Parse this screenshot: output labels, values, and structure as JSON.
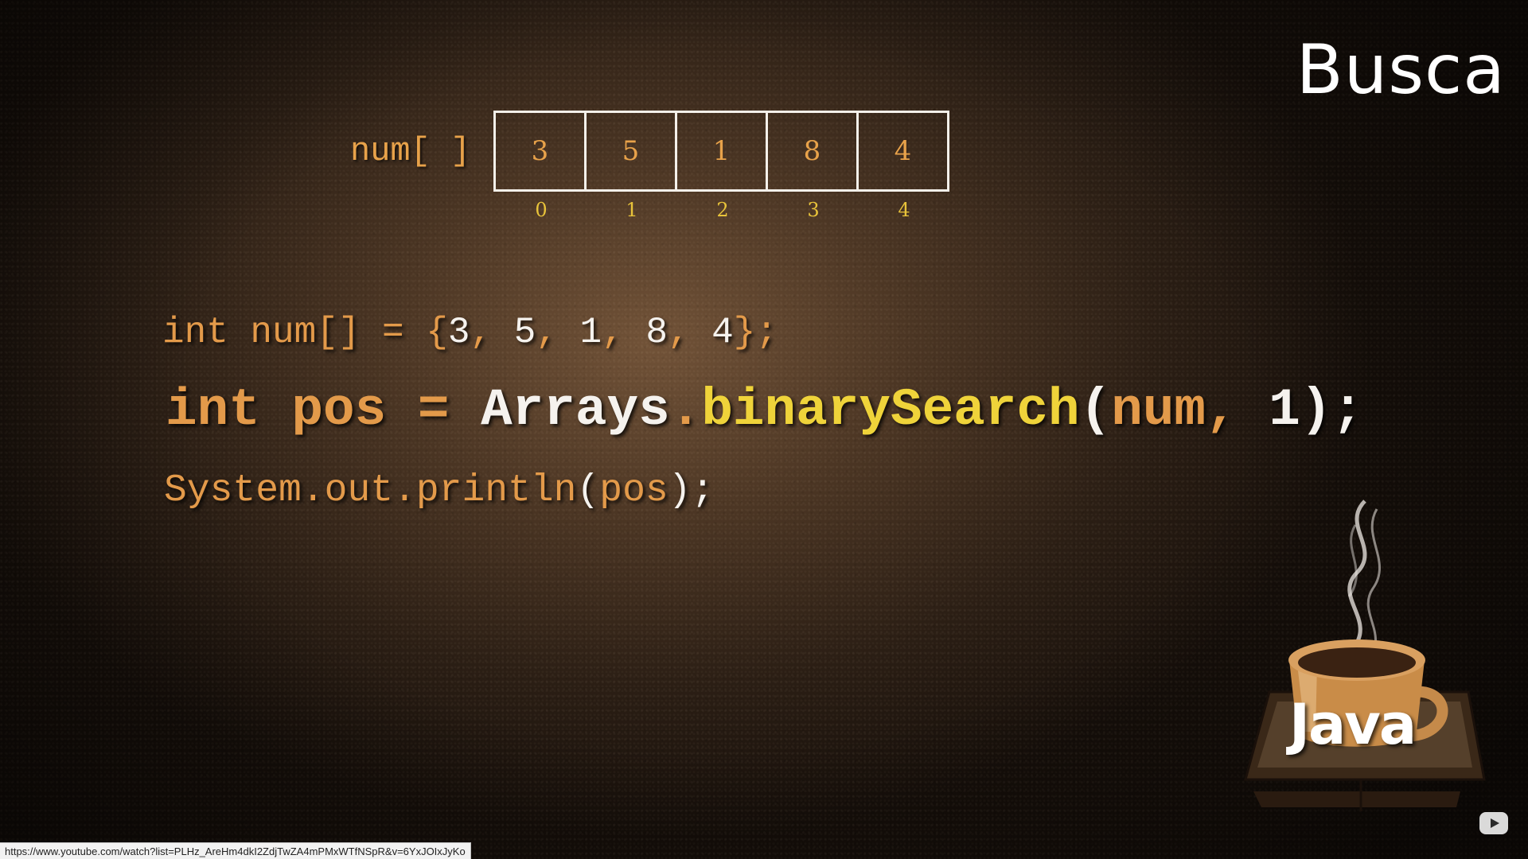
{
  "slide": {
    "title": "Busca",
    "array": {
      "label": "num[ ]",
      "values": [
        "3",
        "5",
        "1",
        "8",
        "4"
      ],
      "indices": [
        "0",
        "1",
        "2",
        "3",
        "4"
      ]
    },
    "code": {
      "line1": {
        "t1": "int num[] = {",
        "t2": "3",
        "t3": ", ",
        "t4": "5",
        "t5": ", ",
        "t6": "1",
        "t7": ", ",
        "t8": "8",
        "t9": ", ",
        "t10": "4",
        "t11": "};"
      },
      "line2": {
        "t1": "int pos = ",
        "t2": "Arrays",
        "t3": ".",
        "t4": "binarySearch",
        "t5": "(",
        "t6": "num,",
        "t7": " 1);"
      },
      "line3": {
        "t1": "System.out.println",
        "t2": "(",
        "t3": "pos",
        "t4": ");"
      }
    },
    "logo_text": "Java"
  },
  "status_bar": {
    "url": "https://www.youtube.com/watch?list=PLHz_AreHm4dkI2ZdjTwZA4mPMxWTfNSpR&v=6YxJOIxJyKo"
  },
  "icons": {
    "player": "youtube-logo-icon",
    "logo": "coffee-cup-icon"
  },
  "colors": {
    "keyword_orange": "#e39a4a",
    "text_white": "#f5f2ee",
    "method_yellow": "#efd33a"
  }
}
